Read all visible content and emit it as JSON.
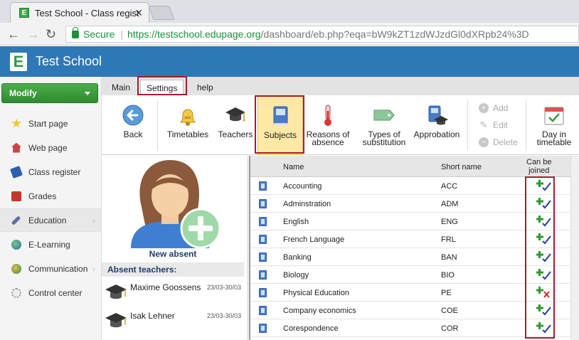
{
  "browser": {
    "tab_title": "Test School - Class regist",
    "secure_label": "Secure",
    "url_green": "https://testschool.edupage.org",
    "url_rest": "/dashboard/eb.php?eqa=bW9kZT1zdWJzdGl0dXRpb24%3D"
  },
  "app": {
    "logo_letter": "E",
    "title": "Test School",
    "header_color": "#2f78b6"
  },
  "sidebar": {
    "modify_label": "Modify",
    "items": [
      {
        "label": "Start page",
        "icon": "star-icon"
      },
      {
        "label": "Web page",
        "icon": "house-icon"
      },
      {
        "label": "Class register",
        "icon": "book-icon"
      },
      {
        "label": "Grades",
        "icon": "grades-icon"
      },
      {
        "label": "Education",
        "icon": "pencil-icon"
      },
      {
        "label": "E-Learning",
        "icon": "globe-icon"
      },
      {
        "label": "Communication",
        "icon": "chat-icon"
      },
      {
        "label": "Control center",
        "icon": "gear-icon"
      }
    ]
  },
  "menubar": {
    "tabs": [
      "Main",
      "Settings",
      "help"
    ]
  },
  "ribbon": {
    "back": "Back",
    "timetables": "Timetables",
    "teachers": "Teachers",
    "subjects": "Subjects",
    "reasons_l1": "Reasons of",
    "reasons_l2": "absence",
    "types_l1": "Types of",
    "types_l2": "substitution",
    "approbation": "Approbation",
    "add": "Add",
    "edit": "Edit",
    "delete": "Delete",
    "day_l1": "Day in",
    "day_l2": "timetable",
    "bell_text": "asc"
  },
  "left": {
    "new_absent": "New absent",
    "absent_header": "Absent teachers:",
    "teachers": [
      {
        "name": "Maxime Goossens",
        "dates": "23/03-30/03"
      },
      {
        "name": "Isak Lehner",
        "dates": "23/03-30/03"
      }
    ]
  },
  "table": {
    "col_name": "Name",
    "col_short": "Short name",
    "col_join_l1": "Can be",
    "col_join_l2": "joined",
    "rows": [
      {
        "name": "Accounting",
        "short": "ACC",
        "joinable": true
      },
      {
        "name": "Adminstration",
        "short": "ADM",
        "joinable": true
      },
      {
        "name": "English",
        "short": "ENG",
        "joinable": true
      },
      {
        "name": "French Language",
        "short": "FRL",
        "joinable": true
      },
      {
        "name": "Banking",
        "short": "BAN",
        "joinable": true
      },
      {
        "name": "Biology",
        "short": "BIO",
        "joinable": true
      },
      {
        "name": "Physical Education",
        "short": "PE",
        "joinable": false
      },
      {
        "name": "Company economics",
        "short": "COE",
        "joinable": true
      },
      {
        "name": "Corespondence",
        "short": "COR",
        "joinable": true
      }
    ]
  }
}
